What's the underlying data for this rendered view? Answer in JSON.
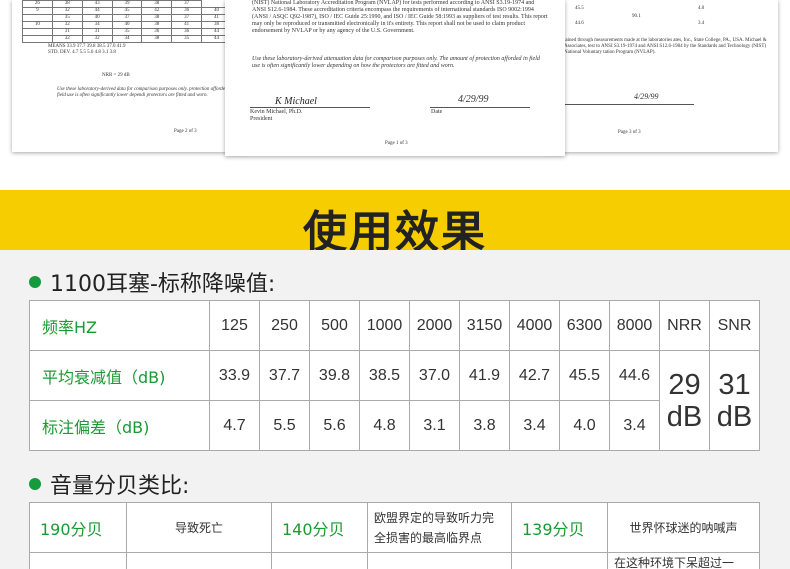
{
  "report_sheets": {
    "left": {
      "rows": [
        [
          "26",
          "38",
          "43",
          "39",
          "38",
          "37"
        ],
        [
          "9",
          "32",
          "44",
          "45",
          "42",
          "36",
          "40"
        ],
        [
          "",
          "35",
          "40",
          "37",
          "38",
          "37",
          "41"
        ],
        [
          "10",
          "32",
          "34",
          "40",
          "38",
          "41",
          "38"
        ],
        [
          "",
          "31",
          "31",
          "35",
          "36",
          "36",
          "44"
        ],
        [
          "",
          "32",
          "32",
          "34",
          "38",
          "35",
          "44"
        ]
      ],
      "means_label": "MEANS",
      "std_label": "STD. DEV.",
      "means_values": [
        "33.9",
        "37.7",
        "39.8",
        "38.5",
        "37.0",
        "41.9"
      ],
      "std_values": [
        "4.7",
        "5.5",
        "5.6",
        "4.8",
        "3.1",
        "3.8"
      ],
      "nrr_text": "NRR =   29   dB",
      "note": "Use these laboratory-derived data for comparison purposes only. protection afforded in field use is often significantly lower dependi protectors are fitted and worn.",
      "page": "Page 2 of 3"
    },
    "center": {
      "paragraph": "(NIST) National Laboratory Accreditation Program (NVLAP) for tests performed according to ANSI S3.19-1974 and ANSI S12.6-1984. These accreditation criteria encompass the requirements of international standards ISO 9002:1994 (ANSI / ASQC Q92-1987), ISO / IEC Guide 25:1990, and ISO / IEC Guide 58:1993 as suppliers of test results. This report may only be reproduced or transmitted electronically in it's entirety. This report shall not be used to claim product endorsement by NVLAP or by any agency of the U.S. Government.",
      "note": "Use these laboratory-derived attenuation data for comparison purposes only. The amount of protection afforded in field use is often significantly lower depending on how the protectors are fitted and worn.",
      "signature": "K Michael",
      "signer_name": "Kevin Michael, Ph.D.",
      "signer_title": "President",
      "date_value": "4/29/99",
      "date_label": "Date",
      "page": "Page 1 of 3"
    },
    "right": {
      "values": [
        "45.5",
        "90.1",
        "4.0",
        "44.6",
        "3.4"
      ],
      "paragraph": "tained through measurements made at the laboratories ates, Inc., State College, PA., USA. Michael & Associates, test to ANSI S3.19-1974 and ANSI S12.6-1984 by the Standards and Technology (NIST) National Voluntary tation Program (NVLAP).",
      "date_value": "4/29/99",
      "page": "Page 3 of 3"
    }
  },
  "banner": {
    "title": "使用效果"
  },
  "spec_section": {
    "title": "1100耳塞-标称降噪值:",
    "header": {
      "label": "频率HZ",
      "freqs": [
        "125",
        "250",
        "500",
        "1000",
        "2000",
        "3150",
        "4000",
        "6300",
        "8000"
      ],
      "nrr": "NRR",
      "snr": "SNR"
    },
    "avg_row": {
      "label": "平均衰减值（dB)",
      "values": [
        "33.9",
        "37.7",
        "39.8",
        "38.5",
        "37.0",
        "41.9",
        "42.7",
        "45.5",
        "44.6"
      ]
    },
    "std_row": {
      "label": "标注偏差（dB)",
      "values": [
        "4.7",
        "5.5",
        "5.6",
        "4.8",
        "3.1",
        "3.8",
        "3.4",
        "4.0",
        "3.4"
      ]
    },
    "nrr_value": "29",
    "snr_value": "31",
    "unit": "dB"
  },
  "level_section": {
    "title": "音量分贝类比:",
    "row1": [
      {
        "db": "190分贝",
        "desc": "导致死亡"
      },
      {
        "db": "140分贝",
        "desc": "欧盟界定的导致听力完全损害的最高临界点"
      },
      {
        "db": "139分贝",
        "desc": "世界怀球迷的呐喊声"
      }
    ],
    "row2_partial": "在这种环境下呆超过一"
  }
}
